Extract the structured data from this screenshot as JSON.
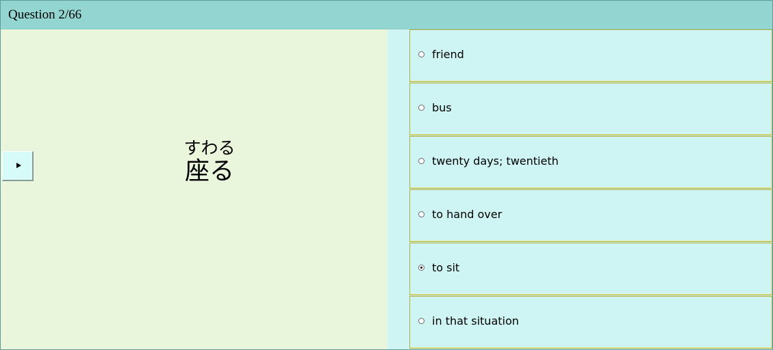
{
  "header": {
    "title": "Question 2/66"
  },
  "word": {
    "reading": "すわる",
    "kanji": "座る"
  },
  "audio": {
    "play_icon": "play-icon"
  },
  "options": [
    {
      "label": "friend",
      "selected": false
    },
    {
      "label": "bus",
      "selected": false
    },
    {
      "label": "twenty days; twentieth",
      "selected": false
    },
    {
      "label": "to hand over",
      "selected": false
    },
    {
      "label": "to sit",
      "selected": true
    },
    {
      "label": "in that situation",
      "selected": false
    }
  ],
  "colors": {
    "title_bar": "#93d5d0",
    "left_panel": "#e9f6dc",
    "option_bg": "#cef5f3",
    "option_border": "#b4b23c"
  }
}
